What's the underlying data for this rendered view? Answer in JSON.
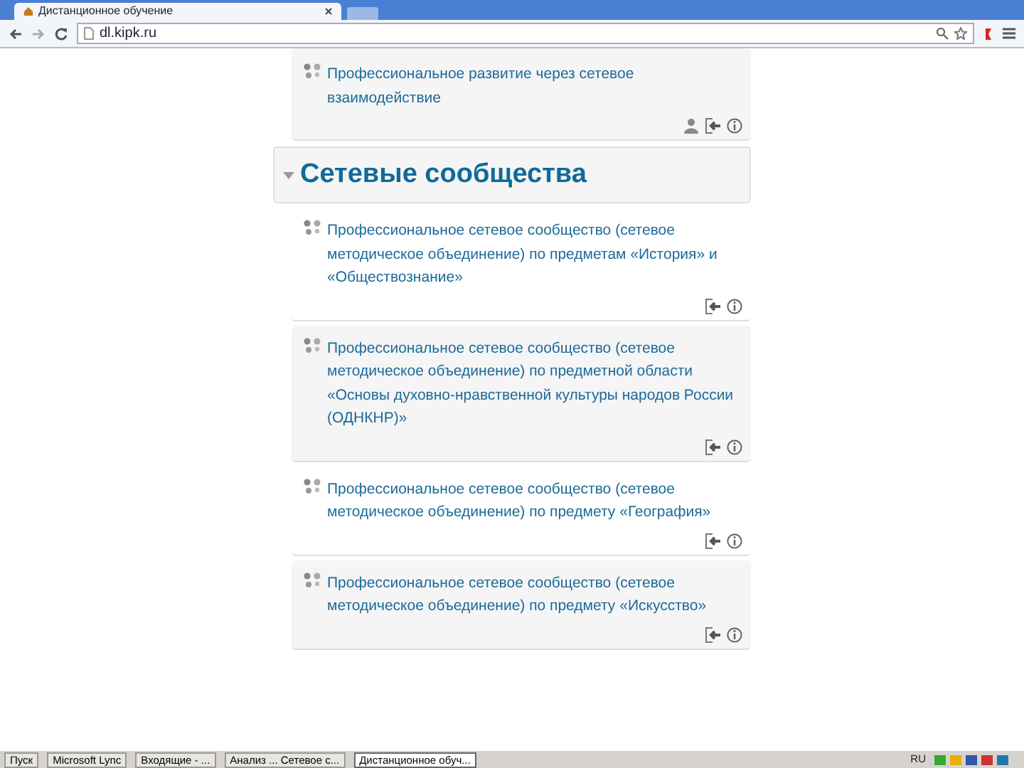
{
  "browser": {
    "tab_title": "Дистанционное обучение",
    "url": "dl.kipk.ru"
  },
  "top_activity": {
    "title": "Профессиональное развитие через сетевое взаимодействие",
    "kind": "restricted"
  },
  "section": {
    "title": "Сетевые сообщества",
    "expanded": true
  },
  "activities": [
    {
      "title": "Профессиональное сетевое сообщество (сетевое методическое объединение) по предметам «История» и «Обществознание»",
      "kind": "open"
    },
    {
      "title": "Профессиональное сетевое сообщество (сетевое методическое объединение) по предметной области «Основы духовно-нравственной культуры народов России (ОДНКНР)»",
      "kind": "open"
    },
    {
      "title": "Профессиональное сетевое сообщество (сетевое методическое объединение) по предмету «География»",
      "kind": "open"
    },
    {
      "title": "Профессиональное сетевое сообщество (сетевое методическое объединение) по предмету «Искусство»",
      "kind": "open"
    }
  ],
  "taskbar": {
    "start": "Пуск",
    "windows": [
      {
        "label": "Microsoft Lync",
        "selected": false
      },
      {
        "label": "Входящие - ...",
        "selected": false
      },
      {
        "label": "Анализ ... Сетевое с...",
        "selected": false
      },
      {
        "label": "Дистанционное обуч...",
        "selected": true
      }
    ],
    "language": "RU"
  }
}
